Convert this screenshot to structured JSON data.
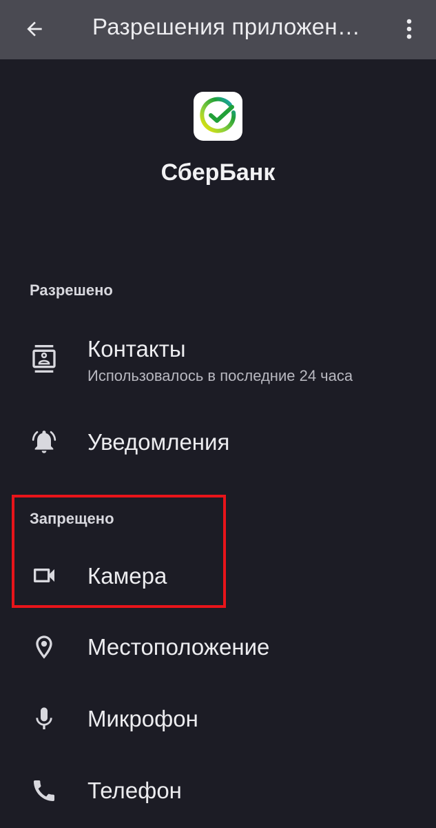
{
  "header": {
    "title": "Разрешения приложен…",
    "back_icon": "arrow-back-icon",
    "more_icon": "more-vert-icon"
  },
  "app": {
    "name": "СберБанк",
    "icon": "sberbank-logo-icon"
  },
  "allowed": {
    "header": "Разрешено",
    "items": [
      {
        "label": "Контакты",
        "subtitle": "Использовалось в последние 24 часа",
        "icon": "contacts-icon"
      },
      {
        "label": "Уведомления",
        "icon": "bell-icon"
      }
    ]
  },
  "denied": {
    "header": "Запрещено",
    "items": [
      {
        "label": "Камера",
        "icon": "camera-icon"
      },
      {
        "label": "Местоположение",
        "icon": "location-icon"
      },
      {
        "label": "Микрофон",
        "icon": "microphone-icon"
      },
      {
        "label": "Телефон",
        "icon": "phone-icon"
      }
    ]
  },
  "colors": {
    "background": "#1c1c25",
    "topbar": "#4a4a52",
    "highlight": "#e8141a"
  }
}
